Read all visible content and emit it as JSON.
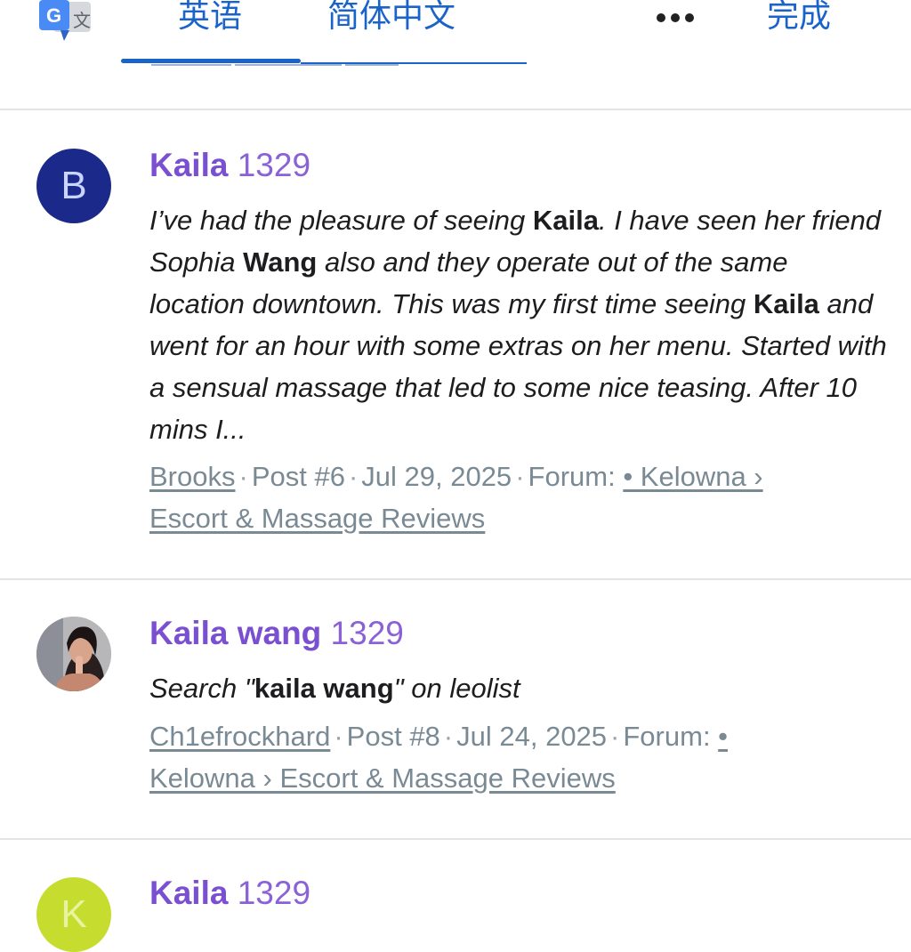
{
  "translate_bar": {
    "source_lang": "英语",
    "target_lang": "简体中文",
    "more_icon": "more-horizontal-icon",
    "done_label": "完成",
    "logo_icon": "google-translate-icon",
    "accent_color": "#1a63c9"
  },
  "results": [
    {
      "avatar_letter": "B",
      "avatar_color": "#1b2a8a",
      "title_name": "Kaila",
      "title_rest": " 1329",
      "snippet": {
        "p1": "I’ve had the pleasure of seeing ",
        "b1": "Kaila",
        "p2": ". I have seen her friend Sophia ",
        "b2": "Wang",
        "p3": " also and they operate out of the same location downtown. This was my first time seeing ",
        "b3": "Kaila",
        "p4": " and went for an hour with some extras on her menu. Started with a sensual massage that led to some nice teasing. After 10 mins I..."
      },
      "meta": {
        "author": "Brooks",
        "post": "Post #6",
        "date": "Jul 29, 2025",
        "forum_prefix": "Forum: ",
        "forum_part1": "• Kelowna ›",
        "forum_part2": "Escort & Massage Reviews"
      }
    },
    {
      "avatar_icon": "user-photo-avatar",
      "title_name": "Kaila wang",
      "title_rest": " 1329",
      "snippet": {
        "p1": "Search \"",
        "b1": "kaila wang",
        "p2": "\" on leolist"
      },
      "meta": {
        "author": "Ch1efrockhard",
        "post": "Post #8",
        "date": "Jul 24, 2025",
        "forum_prefix": "Forum: ",
        "forum_part1": "•",
        "forum_part2": "Kelowna › Escort & Massage Reviews"
      }
    },
    {
      "avatar_letter": "K",
      "avatar_color": "#c6dd2f",
      "title_name": "Kaila",
      "title_rest": " 1329"
    }
  ],
  "colors": {
    "title": "#8a61d6",
    "meta": "#7a8a94",
    "divider": "#e2e4e7"
  }
}
